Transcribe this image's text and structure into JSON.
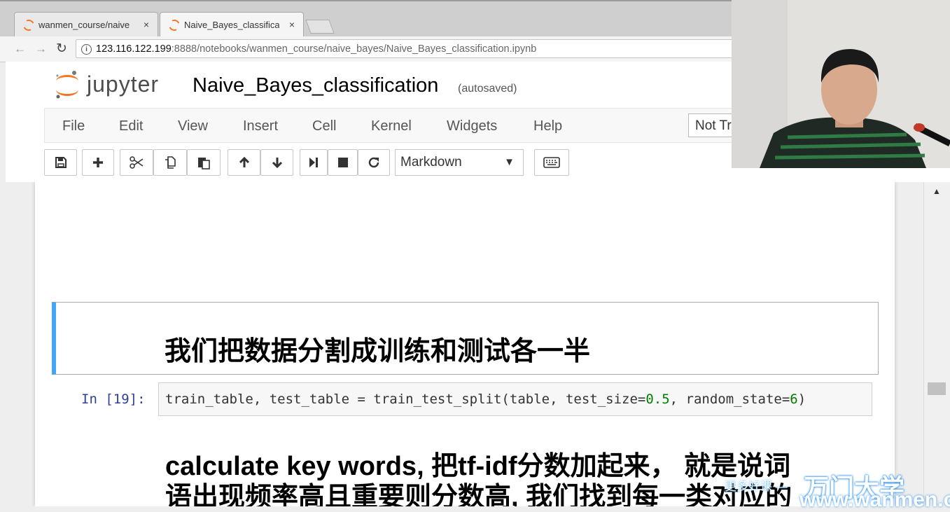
{
  "browser": {
    "tabs": [
      {
        "title": "wanmen_course/naive",
        "close": "×"
      },
      {
        "title": "Naive_Bayes_classificat",
        "close": "×"
      }
    ],
    "nav": {
      "back": "←",
      "forward": "→",
      "reload": "↻"
    },
    "url_host": "123.116.122.199",
    "url_rest": ":8888/notebooks/wanmen_course/naive_bayes/Naive_Bayes_classification.ipynb"
  },
  "jupyter": {
    "logo_text": "jupyter",
    "notebook_title": "Naive_Bayes_classification",
    "autosave": "(autosaved)",
    "menu": [
      "File",
      "Edit",
      "View",
      "Insert",
      "Cell",
      "Kernel",
      "Widgets",
      "Help"
    ],
    "trusted": "Not Tr",
    "cell_type": "Markdown",
    "toolbar_icons": [
      "save-icon",
      "plus-icon",
      "cut-icon",
      "copy-icon",
      "paste-icon",
      "arrow-up-icon",
      "arrow-down-icon",
      "run-icon",
      "stop-icon",
      "restart-icon",
      "keyboard-icon"
    ]
  },
  "cells": {
    "heading": "我们把数据分割成训练和测试各一半",
    "prompt": "In  [19]:",
    "code_a": "train_table, test_table = train_test_split(table, test_size=",
    "code_n1": "0.5",
    "code_b": ", random_state=",
    "code_n2": "6",
    "code_c": ")",
    "md_line1": "calculate key words, 把tf-idf分数加起来， 就是说词",
    "md_line2": "语出现频率高且重要则分数高, 我们找到每一类对应的"
  },
  "watermark": {
    "line1": "更多好课 —",
    "brand": "万门大学",
    "url": "www.wanmen.org"
  },
  "colors": {
    "accent": "#42a5f5",
    "jupyter_orange": "#f37626",
    "prompt": "#303f9f",
    "number": "#008000"
  }
}
